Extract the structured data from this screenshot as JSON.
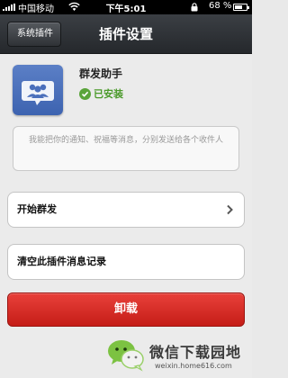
{
  "status_bar": {
    "carrier": "中国移动",
    "time": "下午5:01",
    "battery_percent": "68 %",
    "battery_level": 0.68
  },
  "nav": {
    "back_label": "系统插件",
    "title": "插件设置"
  },
  "plugin": {
    "icon": "group-chat-icon",
    "name": "群发助手",
    "status": "已安装",
    "description": "我能把你的通知、祝福等消息，分别发送给各个收件人"
  },
  "cells": {
    "start": "开始群发",
    "clear": "清空此插件消息记录"
  },
  "uninstall_label": "卸载",
  "watermark": {
    "title": "微信下载园地",
    "url": "weixin.home616.com"
  },
  "colors": {
    "nav_bg": "#2f3236",
    "installed_green": "#4b9a2b",
    "uninstall_red": "#d52a24",
    "icon_blue": "#4a6fbb"
  }
}
